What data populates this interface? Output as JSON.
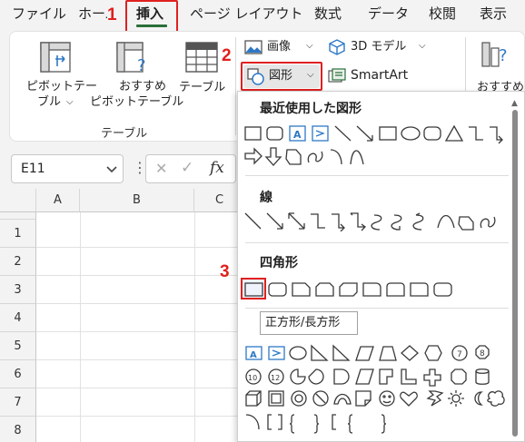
{
  "menu": {
    "tabs": [
      {
        "label": "ファイル"
      },
      {
        "label": "ホーム"
      },
      {
        "label": "挿入"
      },
      {
        "label": "ページ レイアウト"
      },
      {
        "label": "数式"
      },
      {
        "label": "データ"
      },
      {
        "label": "校閲"
      },
      {
        "label": "表示"
      }
    ]
  },
  "steps": [
    "1",
    "2",
    "3"
  ],
  "ribbon": {
    "pivot_label_1": "ピボットテー",
    "pivot_label_2": "ブル",
    "rec_pivot_label_1": "おすすめ",
    "rec_pivot_label_2": "ピボットテーブル",
    "table_label": "テーブル",
    "group_tables": "テーブル",
    "image_label": "画像",
    "model3d_label": "3D モデル",
    "shapes_label": "図形",
    "smartart_label": "SmartArt",
    "recommended_label": "おすすめ"
  },
  "formula_bar": {
    "name_box": "E11",
    "cancel": "✕",
    "enter": "✓",
    "fx": "fx"
  },
  "sheet": {
    "columns": [
      "A",
      "B",
      "C"
    ],
    "rows": [
      "1",
      "2",
      "3",
      "4",
      "5",
      "6",
      "7",
      "8"
    ]
  },
  "dropdown": {
    "recent_title": "最近使用した図形",
    "lines_title": "線",
    "rect_title": "四角形",
    "tooltip": "正方形/長方形"
  },
  "colors": {
    "accent_green": "#2b6e3a",
    "highlight_red": "#e02020",
    "shape_stroke": "#3a3a3a",
    "textbox_blue": "#2e78c6"
  }
}
